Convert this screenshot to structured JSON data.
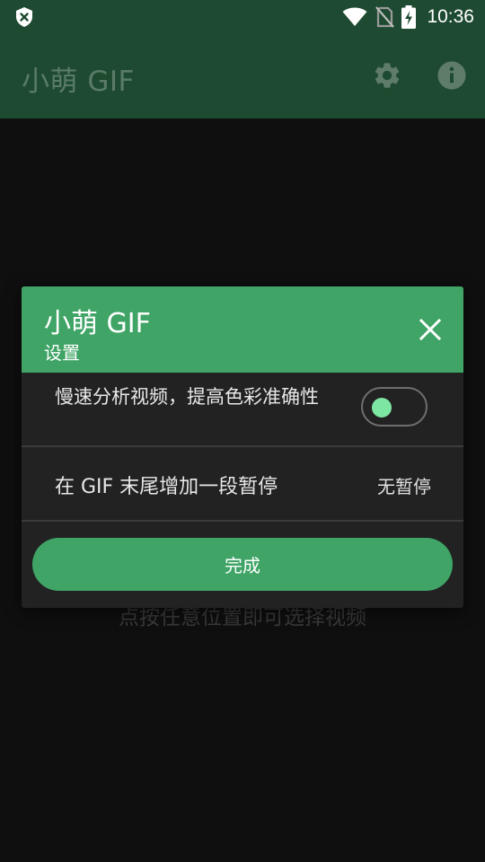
{
  "status_bar": {
    "time": "10:36"
  },
  "app_bar": {
    "title": "小萌 GIF"
  },
  "background": {
    "hint": "点按任意位置即可选择视频"
  },
  "dialog": {
    "title": "小萌 GIF",
    "subtitle": "设置",
    "settings": [
      {
        "label": "慢速分析视频，提高色彩准确性",
        "type": "toggle",
        "checked": false
      },
      {
        "label": "在 GIF 末尾增加一段暂停",
        "type": "value",
        "value": "无暂停"
      }
    ],
    "done_label": "完成"
  },
  "colors": {
    "primary": "#3fa466",
    "appbar": "#1d4a30",
    "dialog_bg": "#222222",
    "switch_knob": "#7ee6a3"
  },
  "icons": [
    "shield-x-icon",
    "wifi-icon",
    "no-sim-icon",
    "battery-charging-icon",
    "gear-icon",
    "info-icon",
    "close-icon"
  ]
}
